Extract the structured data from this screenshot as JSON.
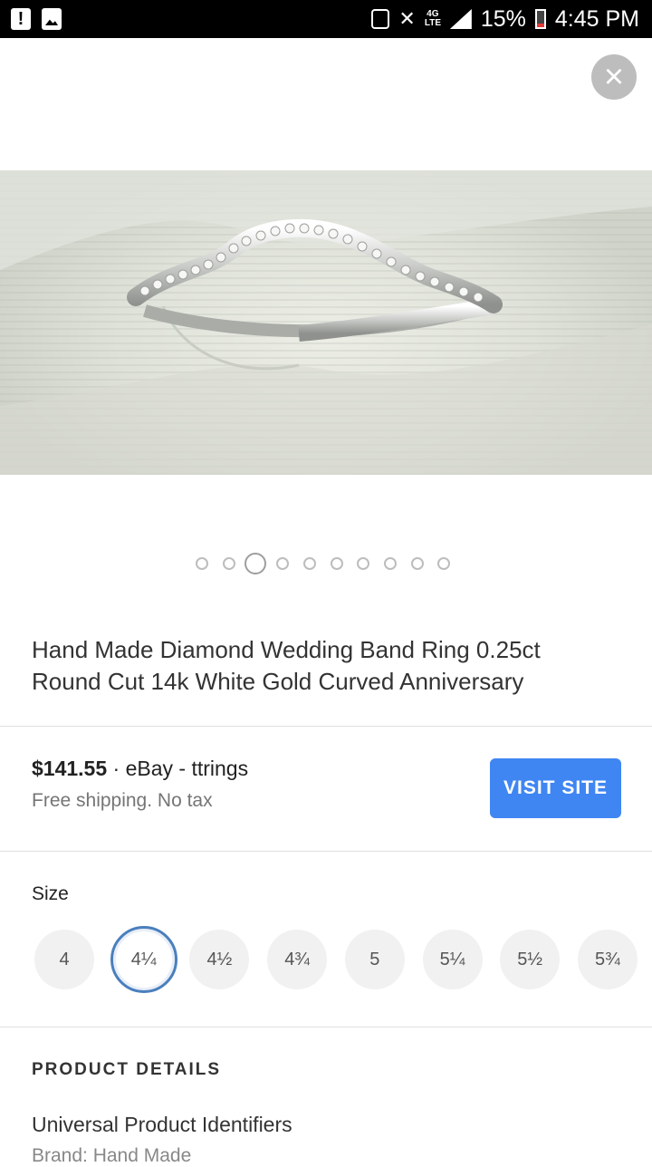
{
  "status_bar": {
    "battery": "15%",
    "time": "4:45 PM",
    "network": "4G LTE"
  },
  "icons": {
    "close": "close-icon",
    "left": [
      "alert-icon",
      "image-icon"
    ]
  },
  "carousel": {
    "count": 10,
    "active_index": 2
  },
  "product": {
    "title": "Hand Made Diamond Wedding Band Ring 0.25ct Round Cut 14k White Gold Curved Anniversary",
    "price": "$141.55",
    "seller": " · eBay - ttrings",
    "shipping": "Free shipping. No tax",
    "visit_label": "VISIT SITE"
  },
  "size": {
    "label": "Size",
    "options": [
      "4",
      "4¼",
      "4½",
      "4¾",
      "5",
      "5¼",
      "5½",
      "5¾"
    ],
    "selected": "4¼"
  },
  "details": {
    "heading": "PRODUCT DETAILS",
    "section": "Universal Product Identifiers",
    "brand": "Brand: Hand Made"
  },
  "colors": {
    "accent": "#3f86f3",
    "selected_ring": "#4a7fbd"
  }
}
